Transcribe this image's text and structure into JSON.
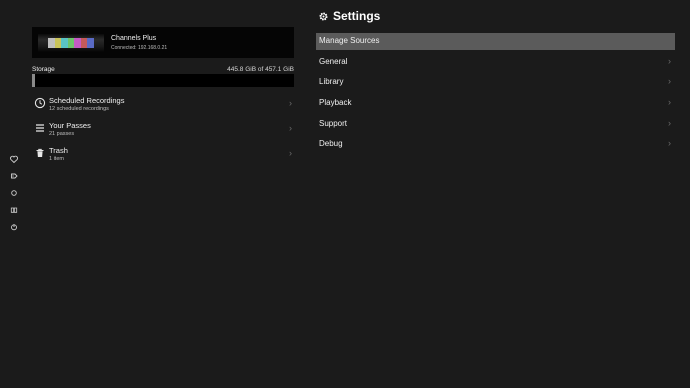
{
  "server": {
    "name": "Channels Plus",
    "status": "Connected: 192.168.0.21"
  },
  "storage": {
    "label": "Storage",
    "value_text": "445.8 GiB of 457.1 GiB",
    "used_gib": 445.8,
    "total_gib": 457.1,
    "bar_fill_fraction": 0.01
  },
  "left_list": [
    {
      "title": "Scheduled Recordings",
      "subtitle": "12 scheduled recordings",
      "icon": "clock-icon"
    },
    {
      "title": "Your Passes",
      "subtitle": "21 passes",
      "icon": "list-icon"
    },
    {
      "title": "Trash",
      "subtitle": "1 item",
      "icon": "trash-icon"
    }
  ],
  "settings": {
    "title": "Settings",
    "menu": [
      {
        "label": "Manage Sources",
        "selected": true
      },
      {
        "label": "General"
      },
      {
        "label": "Library"
      },
      {
        "label": "Playback"
      },
      {
        "label": "Support"
      },
      {
        "label": "Debug"
      }
    ]
  },
  "rail_icons": [
    "heart-icon",
    "tag-icon",
    "circle-icon",
    "book-icon",
    "power-icon"
  ],
  "colors": {
    "background": "#1b1b1b",
    "selected_item": "#5b5b5b",
    "card": "#050505",
    "storage_fill": "#8a8a8a"
  }
}
